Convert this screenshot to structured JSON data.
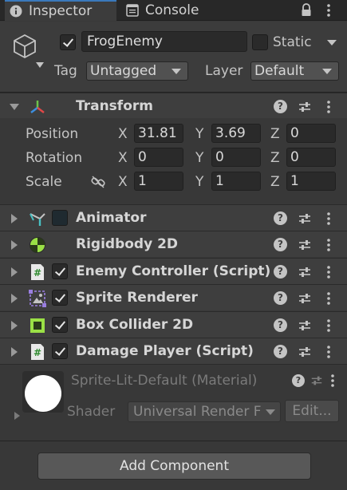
{
  "tabs": [
    {
      "label": "Inspector",
      "icon": "info-icon",
      "active": true
    },
    {
      "label": "Console",
      "icon": "console-icon",
      "active": false
    }
  ],
  "header": {
    "object_name": "FrogEnemy",
    "active": true,
    "static_label": "Static",
    "static_checked": false,
    "tag_label": "Tag",
    "tag_value": "Untagged",
    "layer_label": "Layer",
    "layer_value": "Default"
  },
  "transform": {
    "title": "Transform",
    "rows": [
      {
        "label": "Position",
        "x": "31.81",
        "y": "3.69",
        "z": "0"
      },
      {
        "label": "Rotation",
        "x": "0",
        "y": "0",
        "z": "0"
      },
      {
        "label": "Scale",
        "x": "1",
        "y": "1",
        "z": "1"
      }
    ],
    "axes": {
      "x": "X",
      "y": "Y",
      "z": "Z"
    }
  },
  "components": [
    {
      "title": "Animator",
      "icon": "animator-icon",
      "checkbox": "dark"
    },
    {
      "title": "Rigidbody 2D",
      "icon": "rigidbody-icon",
      "checkbox": "none"
    },
    {
      "title": "Enemy Controller (Script)",
      "icon": "script-icon",
      "checkbox": "checked"
    },
    {
      "title": "Sprite Renderer",
      "icon": "sprite-renderer-icon",
      "checkbox": "checked"
    },
    {
      "title": "Box Collider 2D",
      "icon": "box-collider-icon",
      "checkbox": "checked"
    },
    {
      "title": "Damage Player (Script)",
      "icon": "script-icon",
      "checkbox": "checked"
    }
  ],
  "material": {
    "title": "Sprite-Lit-Default (Material)",
    "shader_label": "Shader",
    "shader_value": "Universal Render F",
    "edit_label": "Edit..."
  },
  "add_component_label": "Add Component",
  "colors": {
    "active_tab_accent": "#3a79bb",
    "panel_bg": "#383838",
    "component_header_bg": "#3e3e3e"
  }
}
